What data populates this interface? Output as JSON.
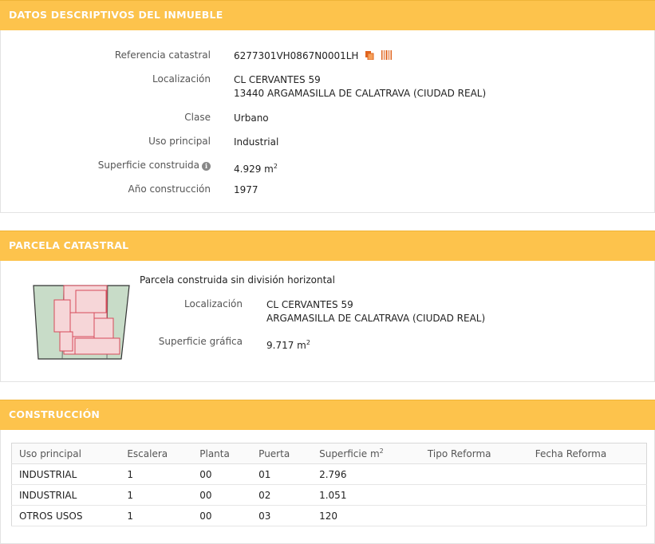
{
  "sections": {
    "descriptivos": "DATOS DESCRIPTIVOS DEL INMUEBLE",
    "parcela": "PARCELA CATASTRAL",
    "construccion": "CONSTRUCCIÓN"
  },
  "inmueble": {
    "referencia_label": "Referencia catastral",
    "referencia_value": "6277301VH0867N0001LH",
    "localizacion_label": "Localización",
    "localizacion_line1": "CL CERVANTES 59",
    "localizacion_line2": "13440 ARGAMASILLA DE CALATRAVA (CIUDAD REAL)",
    "clase_label": "Clase",
    "clase_value": "Urbano",
    "uso_label": "Uso principal",
    "uso_value": "Industrial",
    "superficie_label": "Superficie construida",
    "superficie_value": "4.929 m",
    "superficie_unit_exp": "2",
    "anio_label": "Año construcción",
    "anio_value": "1977"
  },
  "parcela": {
    "title": "Parcela construida sin división horizontal",
    "localizacion_label": "Localización",
    "localizacion_line1": "CL CERVANTES 59",
    "localizacion_line2": "ARGAMASILLA DE CALATRAVA (CIUDAD REAL)",
    "superficie_label": "Superficie gráfica",
    "superficie_value": "9.717 m",
    "superficie_unit_exp": "2"
  },
  "construccion": {
    "columns": [
      "Uso principal",
      "Escalera",
      "Planta",
      "Puerta",
      "Superficie m",
      "Tipo Reforma",
      "Fecha Reforma"
    ],
    "superficie_exp": "2",
    "rows": [
      [
        "INDUSTRIAL",
        "1",
        "00",
        "01",
        "2.796",
        "",
        ""
      ],
      [
        "INDUSTRIAL",
        "1",
        "00",
        "02",
        "1.051",
        "",
        ""
      ],
      [
        "OTROS USOS",
        "1",
        "00",
        "03",
        "120",
        "",
        ""
      ]
    ]
  },
  "colors": {
    "header_bg": "#fdc34c",
    "icon_orange": "#e0641e",
    "parcel_green": "#c8dcc8",
    "building_pink": "#f6d6d8",
    "building_red": "#d64b5a"
  },
  "icons": [
    "copy-icon",
    "barcode-icon",
    "info-icon",
    "parcel-map"
  ]
}
